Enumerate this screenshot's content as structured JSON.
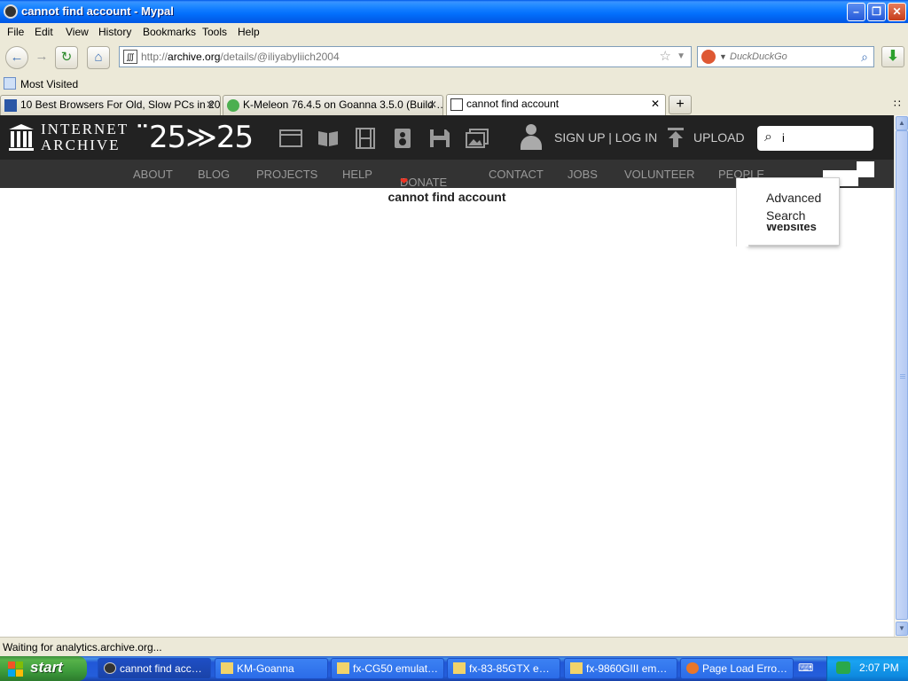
{
  "window": {
    "title": "cannot find account - Mypal",
    "min_label": "–",
    "max_label": "❐",
    "close_label": "✕"
  },
  "menu": [
    "File",
    "Edit",
    "View",
    "History",
    "Bookmarks",
    "Tools",
    "Help"
  ],
  "navigation": {
    "back_glyph": "←",
    "forward_glyph": "→",
    "reload_glyph": "↻",
    "home_glyph": "⌂",
    "url_prefix": "http://",
    "url_host": "archive.org",
    "url_path": "/details/@iliyabyliich2004",
    "star_glyph": "☆",
    "dropdown_glyph": "▼",
    "search_placeholder": "DuckDuckGo",
    "search_glyph": "⌕",
    "download_glyph": "⬇"
  },
  "bookmarks": {
    "most_visited": "Most Visited"
  },
  "tabs": [
    {
      "label": "10 Best Browsers For Old, Slow PCs in 20…",
      "icon": "tv-icon",
      "active": false
    },
    {
      "label": "K-Meleon 76.4.5 on Goanna 3.5.0 (Build …",
      "icon": "chameleon-icon",
      "active": false
    },
    {
      "label": "cannot find account",
      "icon": "archive-icon",
      "active": true
    }
  ],
  "tab_close_glyph": "✕",
  "new_tab_glyph": "+",
  "tab_list_glyph": "∷",
  "archive": {
    "logo_line1": "INTERNET",
    "logo_line2": "ARCHIVE",
    "anniversary": "¨25≫25",
    "signup_login": "SIGN UP | LOG IN",
    "upload": "UPLOAD",
    "search_value": "i",
    "search_glyph": "⌕",
    "nav": [
      "ABOUT",
      "BLOG",
      "PROJECTS",
      "HELP",
      "DONATE",
      "CONTACT",
      "JOBS",
      "VOLUNTEER",
      "PEOPLE"
    ],
    "donate_heart": "❤",
    "advanced_search_line1": "Advanced",
    "advanced_search_line2": "Search",
    "dropdown_partial": "Websites",
    "page_message": "cannot find account"
  },
  "status": {
    "text": "Waiting for analytics.archive.org..."
  },
  "taskbar": {
    "start": "start",
    "items": [
      {
        "label": "cannot find acc…",
        "icon": "mypal-icon",
        "active": true
      },
      {
        "label": "KM-Goanna",
        "icon": "folder-icon",
        "active": false
      },
      {
        "label": "fx-CG50 emulat…",
        "icon": "folder-icon",
        "active": false
      },
      {
        "label": "fx-83-85GTX e…",
        "icon": "folder-icon",
        "active": false
      },
      {
        "label": "fx-9860GIII em…",
        "icon": "folder-icon",
        "active": false
      },
      {
        "label": "Page Load Erro…",
        "icon": "browser-icon",
        "active": false
      }
    ],
    "clock": "2:07 PM"
  },
  "colors": {
    "titlebar": "#0058e6",
    "ia_header": "#222222",
    "ia_nav": "#333333",
    "donate_heart": "#ee3322",
    "taskbar": "#245edb",
    "start_button": "#3d9b3b"
  }
}
